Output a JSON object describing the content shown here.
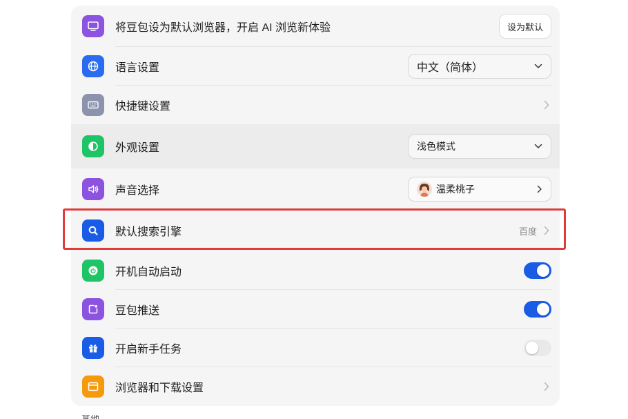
{
  "rows": [
    {
      "label": "将豆包设为默认浏览器，开启 AI 浏览新体验",
      "button": "设为默认",
      "icon": "monitor-icon",
      "color": "#8b53e0"
    },
    {
      "label": "语言设置",
      "select_value": "中文（简体）",
      "icon": "globe-icon",
      "color": "#2a6cf0"
    },
    {
      "label": "快捷键设置",
      "icon": "keyboard-icon",
      "color": "#8c93ad"
    },
    {
      "label": "外观设置",
      "select_value": "浅色模式",
      "icon": "contrast-icon",
      "color": "#1fc466"
    },
    {
      "label": "声音选择",
      "select_value": "温柔桃子",
      "icon": "speaker-icon",
      "color": "#8b53e0"
    },
    {
      "label": "默认搜索引擎",
      "value": "百度",
      "icon": "search-icon",
      "color": "#1a5ce5"
    },
    {
      "label": "开机自动启动",
      "toggle": true,
      "icon": "power-icon",
      "color": "#1fc466"
    },
    {
      "label": "豆包推送",
      "toggle": true,
      "icon": "notification-icon",
      "color": "#8b53e0"
    },
    {
      "label": "开启新手任务",
      "toggle": false,
      "icon": "gift-icon",
      "color": "#1a5ce5"
    },
    {
      "label": "浏览器和下载设置",
      "icon": "browser-window-icon",
      "color": "#f59a0c"
    }
  ],
  "accent_color": "#1a5ce5",
  "highlight_color": "#e03a3a",
  "footer_peek": "其他"
}
